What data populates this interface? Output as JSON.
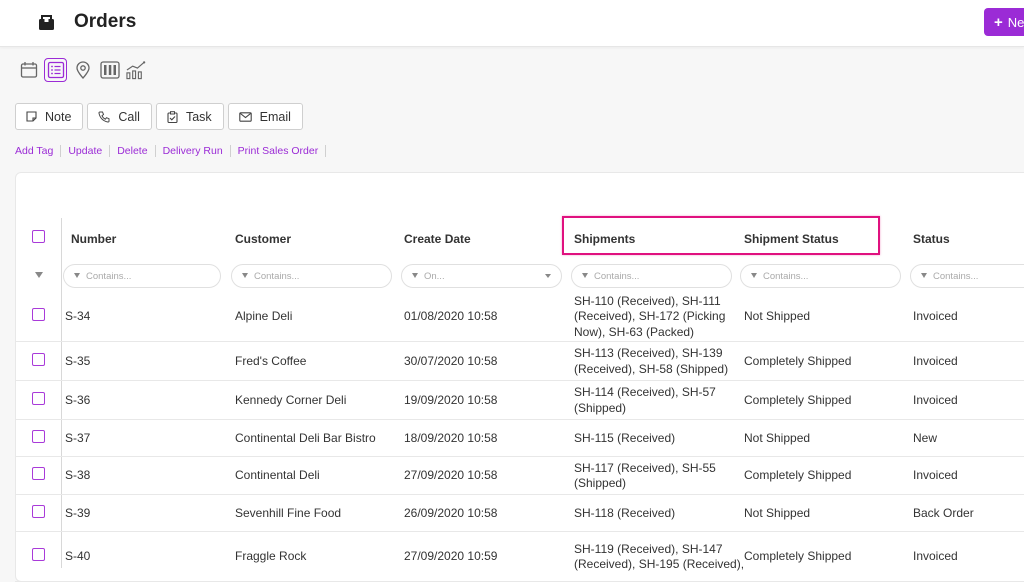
{
  "header": {
    "title": "Orders",
    "new_label": "Ne"
  },
  "views": [
    "calendar-icon",
    "list-icon",
    "map-pin-icon",
    "kanban-icon",
    "chart-icon"
  ],
  "actions": {
    "note": "Note",
    "call": "Call",
    "task": "Task",
    "email": "Email"
  },
  "links": {
    "add_tag": "Add Tag",
    "update": "Update",
    "delete": "Delete",
    "delivery_run": "Delivery Run",
    "print_sales_order": "Print Sales Order"
  },
  "columns": {
    "number": "Number",
    "customer": "Customer",
    "create_date": "Create Date",
    "shipments": "Shipments",
    "shipment_status": "Shipment Status",
    "status": "Status"
  },
  "filters": {
    "number": "Contains...",
    "customer": "Contains...",
    "create_date": "On...",
    "shipments": "Contains...",
    "shipment_status": "Contains...",
    "status": "Contains..."
  },
  "accent_color": "#9b2bd6",
  "highlight_color": "#e0117f",
  "rows": [
    {
      "number": "S-34",
      "customer": "Alpine Deli",
      "date": "01/08/2020 10:58",
      "shipments": [
        "SH-110 (Received), SH-111",
        "(Received), SH-172 (Picking",
        "Now), SH-63 (Packed)"
      ],
      "shipment_status": "Not Shipped",
      "status": "Invoiced"
    },
    {
      "number": "S-35",
      "customer": "Fred's Coffee",
      "date": "30/07/2020 10:58",
      "shipments": [
        "SH-113 (Received), SH-139",
        "(Received), SH-58 (Shipped)"
      ],
      "shipment_status": "Completely Shipped",
      "status": "Invoiced"
    },
    {
      "number": "S-36",
      "customer": "Kennedy Corner Deli",
      "date": "19/09/2020 10:58",
      "shipments": [
        "SH-114 (Received), SH-57",
        "(Shipped)"
      ],
      "shipment_status": "Completely Shipped",
      "status": "Invoiced"
    },
    {
      "number": "S-37",
      "customer": "Continental Deli Bar Bistro",
      "date": "18/09/2020 10:58",
      "shipments": [
        "SH-115 (Received)"
      ],
      "shipment_status": "Not Shipped",
      "status": "New"
    },
    {
      "number": "S-38",
      "customer": "Continental Deli",
      "date": "27/09/2020 10:58",
      "shipments": [
        "SH-117 (Received), SH-55",
        "(Shipped)"
      ],
      "shipment_status": "Completely Shipped",
      "status": "Invoiced"
    },
    {
      "number": "S-39",
      "customer": "Sevenhill Fine Food",
      "date": "26/09/2020 10:58",
      "shipments": [
        "SH-118 (Received)"
      ],
      "shipment_status": "Not Shipped",
      "status": "Back Order"
    },
    {
      "number": "S-40",
      "customer": "Fraggle Rock",
      "date": "27/09/2020 10:59",
      "shipments": [
        "SH-119 (Received), SH-147",
        "(Received), SH-195 (Received),"
      ],
      "shipment_status": "Completely Shipped",
      "status": "Invoiced"
    }
  ]
}
